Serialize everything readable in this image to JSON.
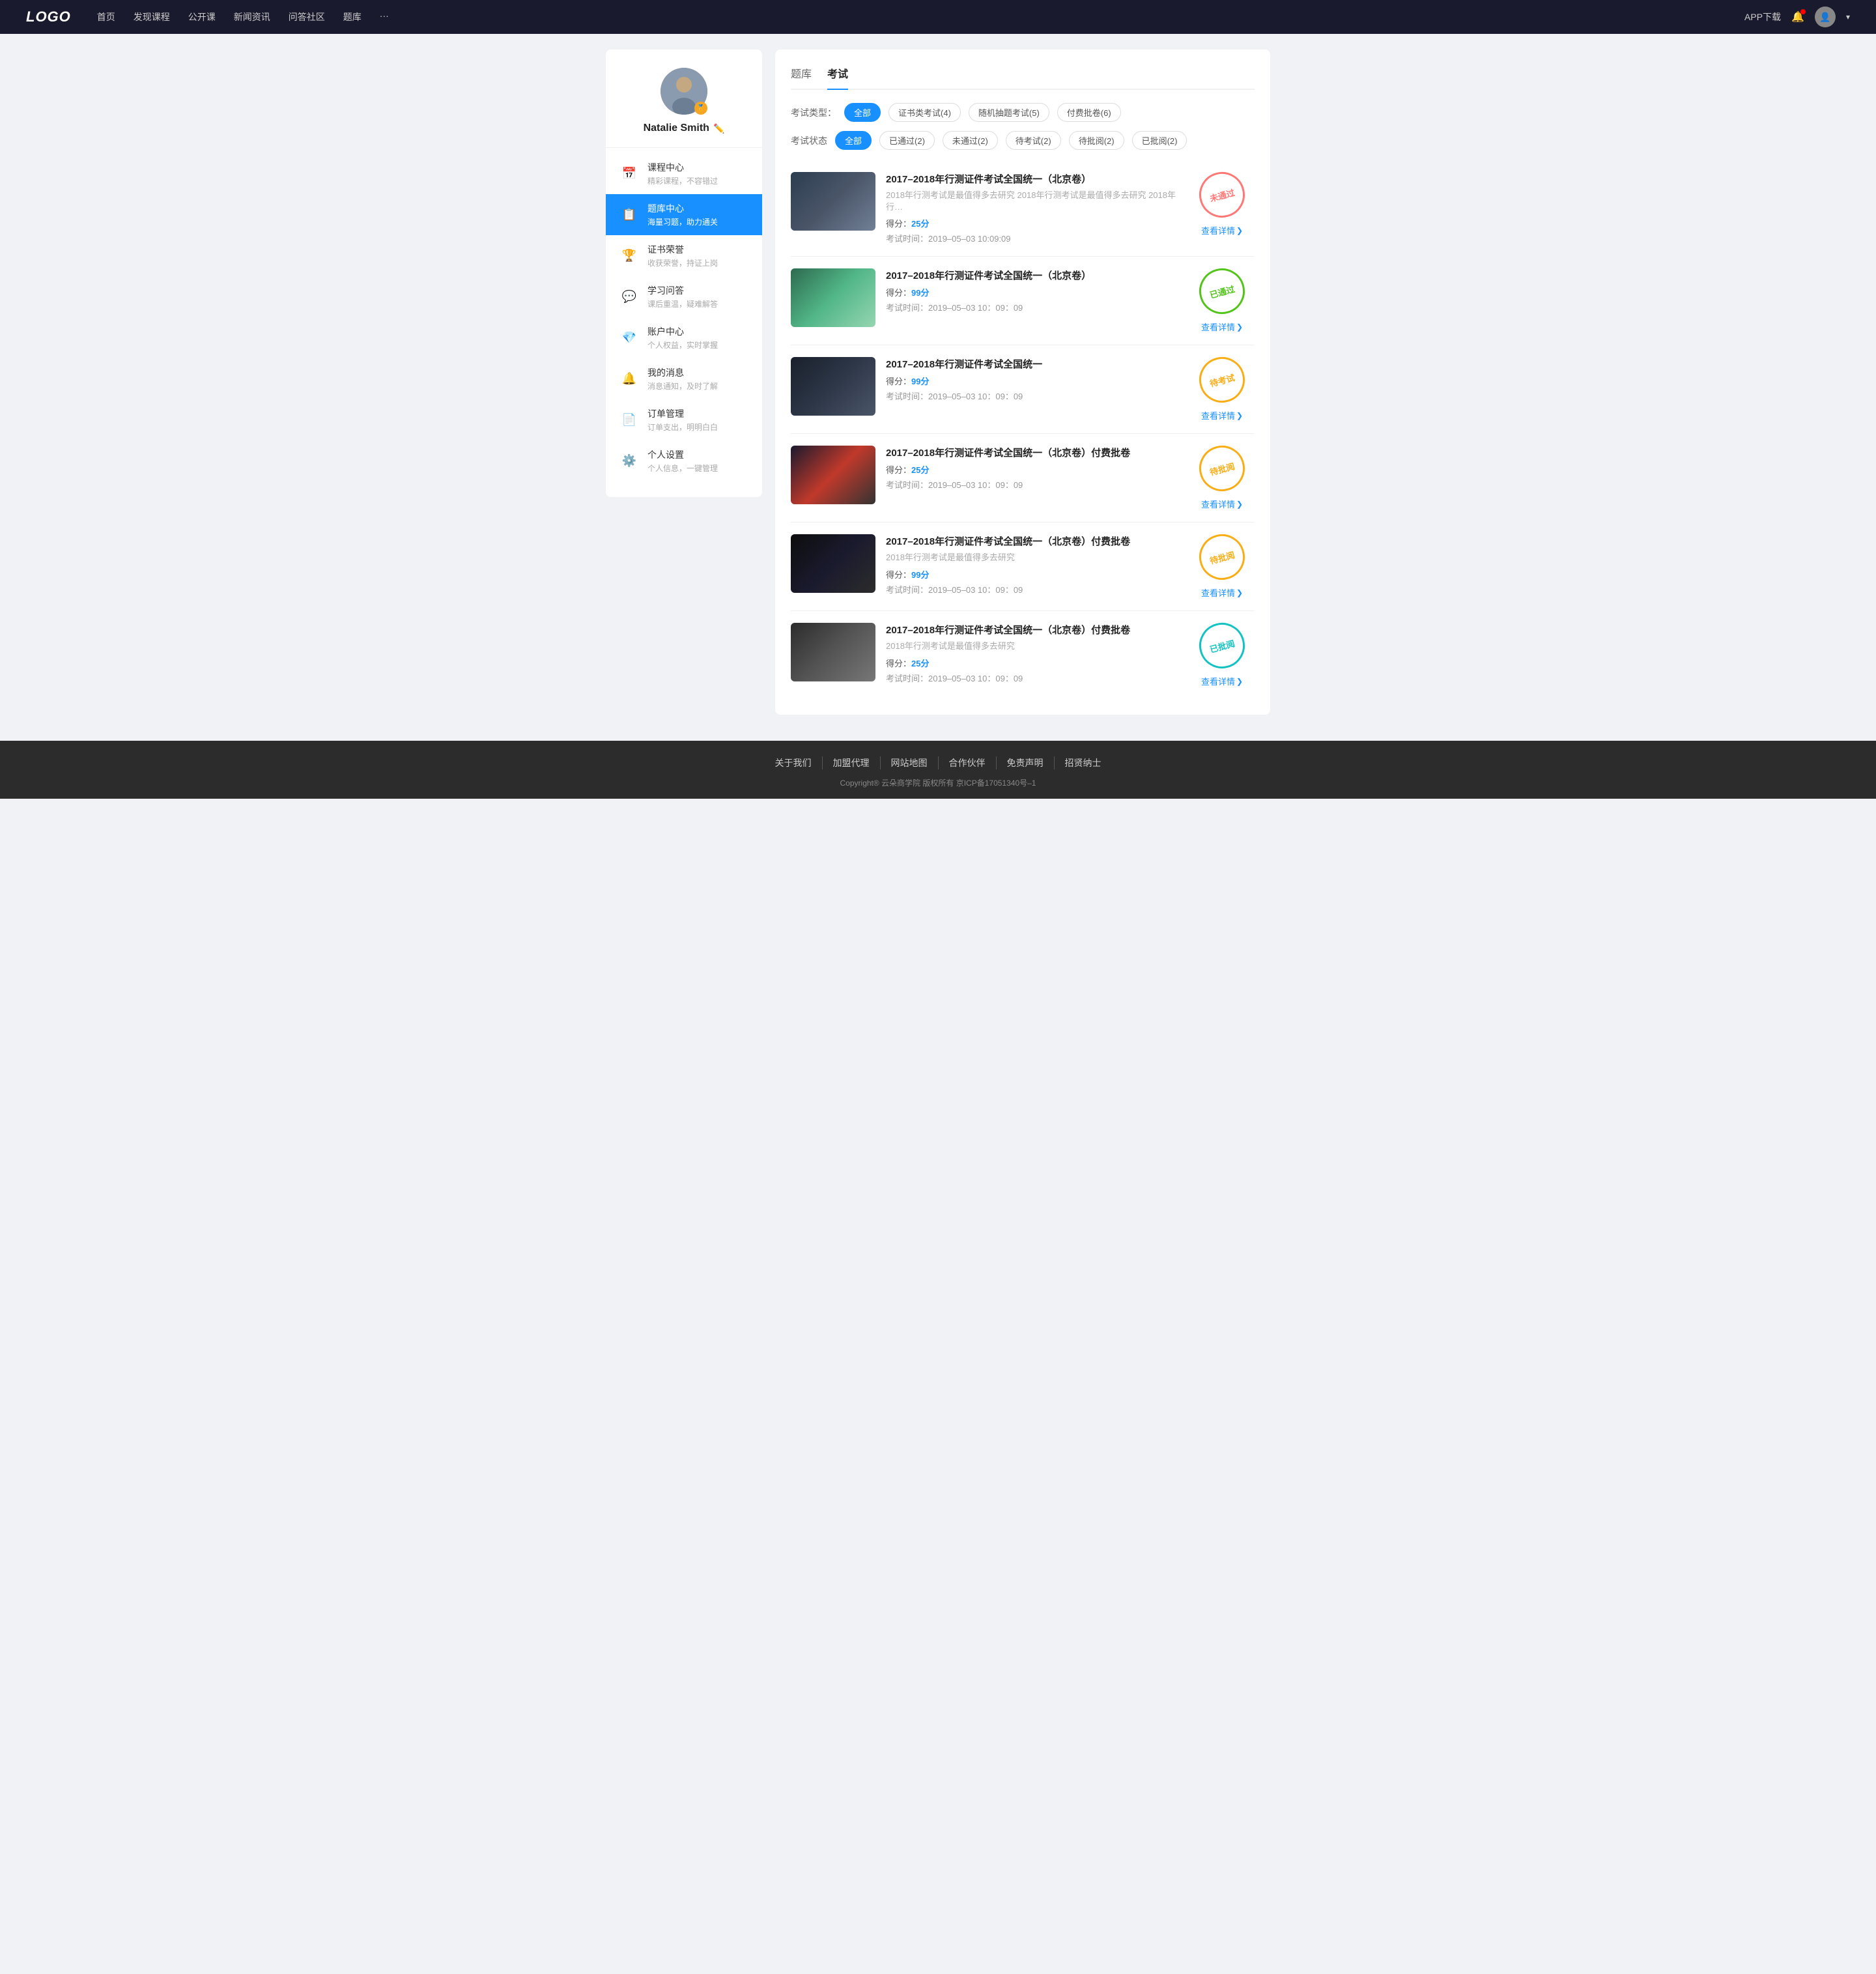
{
  "header": {
    "logo": "LOGO",
    "nav": [
      {
        "label": "首页"
      },
      {
        "label": "发现课程"
      },
      {
        "label": "公开课"
      },
      {
        "label": "新闻资讯"
      },
      {
        "label": "问答社区"
      },
      {
        "label": "题库"
      },
      {
        "label": "···"
      }
    ],
    "app_download": "APP下载",
    "more_icon": "···"
  },
  "sidebar": {
    "username": "Natalie Smith",
    "menu": [
      {
        "icon": "📅",
        "title": "课程中心",
        "subtitle": "精彩课程，不容错过",
        "active": false
      },
      {
        "icon": "📋",
        "title": "题库中心",
        "subtitle": "海量习题，助力通关",
        "active": true
      },
      {
        "icon": "🏆",
        "title": "证书荣誉",
        "subtitle": "收获荣誉，持证上岗",
        "active": false
      },
      {
        "icon": "💬",
        "title": "学习问答",
        "subtitle": "课后重温，疑难解答",
        "active": false
      },
      {
        "icon": "💎",
        "title": "账户中心",
        "subtitle": "个人权益，实时掌握",
        "active": false
      },
      {
        "icon": "🔔",
        "title": "我的消息",
        "subtitle": "消息通知，及时了解",
        "active": false
      },
      {
        "icon": "📄",
        "title": "订单管理",
        "subtitle": "订单支出，明明白白",
        "active": false
      },
      {
        "icon": "⚙️",
        "title": "个人设置",
        "subtitle": "个人信息，一键管理",
        "active": false
      }
    ]
  },
  "content": {
    "tabs": [
      {
        "label": "题库",
        "active": false
      },
      {
        "label": "考试",
        "active": true
      }
    ],
    "type_filter": {
      "label": "考试类型：",
      "options": [
        {
          "label": "全部",
          "active": true
        },
        {
          "label": "证书类考试(4)",
          "active": false
        },
        {
          "label": "随机抽题考试(5)",
          "active": false
        },
        {
          "label": "付费批卷(6)",
          "active": false
        }
      ]
    },
    "status_filter": {
      "label": "考试状态",
      "options": [
        {
          "label": "全部",
          "active": true
        },
        {
          "label": "已通过(2)",
          "active": false
        },
        {
          "label": "未通过(2)",
          "active": false
        },
        {
          "label": "待考试(2)",
          "active": false
        },
        {
          "label": "待批阅(2)",
          "active": false
        },
        {
          "label": "已批阅(2)",
          "active": false
        }
      ]
    },
    "exams": [
      {
        "id": 1,
        "title": "2017–2018年行测证件考试全国统一（北京卷）",
        "desc": "2018年行测考试是最值得多去研究 2018年行测考试是最值得多去研究 2018年行…",
        "score_label": "得分：",
        "score": "25分",
        "time_label": "考试时间：",
        "time": "2019–05–03  10:09:09",
        "thumb_class": "thumb-1",
        "stamp_type": "failed",
        "stamp_text": "未通过",
        "detail_label": "查看详情"
      },
      {
        "id": 2,
        "title": "2017–2018年行测证件考试全国统一（北京卷）",
        "desc": "",
        "score_label": "得分：",
        "score": "99分",
        "time_label": "考试时间：",
        "time": "2019–05–03  10：09：09",
        "thumb_class": "thumb-2",
        "stamp_type": "passed",
        "stamp_text": "已通过",
        "detail_label": "查看详情"
      },
      {
        "id": 3,
        "title": "2017–2018年行测证件考试全国统一",
        "desc": "",
        "score_label": "得分：",
        "score": "99分",
        "time_label": "考试时间：",
        "time": "2019–05–03  10：09：09",
        "thumb_class": "thumb-3",
        "stamp_type": "pending",
        "stamp_text": "待考试",
        "detail_label": "查看详情"
      },
      {
        "id": 4,
        "title": "2017–2018年行测证件考试全国统一（北京卷）付费批卷",
        "desc": "",
        "score_label": "得分：",
        "score": "25分",
        "time_label": "考试时间：",
        "time": "2019–05–03  10：09：09",
        "thumb_class": "thumb-4",
        "stamp_type": "review",
        "stamp_text": "待批阅",
        "detail_label": "查看详情"
      },
      {
        "id": 5,
        "title": "2017–2018年行测证件考试全国统一（北京卷）付费批卷",
        "desc": "2018年行测考试是最值得多去研究",
        "score_label": "得分：",
        "score": "99分",
        "time_label": "考试时间：",
        "time": "2019–05–03  10：09：09",
        "thumb_class": "thumb-5",
        "stamp_type": "review",
        "stamp_text": "待批阅",
        "detail_label": "查看详情"
      },
      {
        "id": 6,
        "title": "2017–2018年行测证件考试全国统一（北京卷）付费批卷",
        "desc": "2018年行测考试是最值得多去研究",
        "score_label": "得分：",
        "score": "25分",
        "time_label": "考试时间：",
        "time": "2019–05–03  10：09：09",
        "thumb_class": "thumb-6",
        "stamp_type": "reviewed",
        "stamp_text": "已批阅",
        "detail_label": "查看详情"
      }
    ]
  },
  "footer": {
    "links": [
      {
        "label": "关于我们"
      },
      {
        "label": "加盟代理"
      },
      {
        "label": "网站地图"
      },
      {
        "label": "合作伙伴"
      },
      {
        "label": "免责声明"
      },
      {
        "label": "招贤纳士"
      }
    ],
    "copyright": "Copyright® 云朵商学院  版权所有    京ICP备17051340号–1"
  }
}
